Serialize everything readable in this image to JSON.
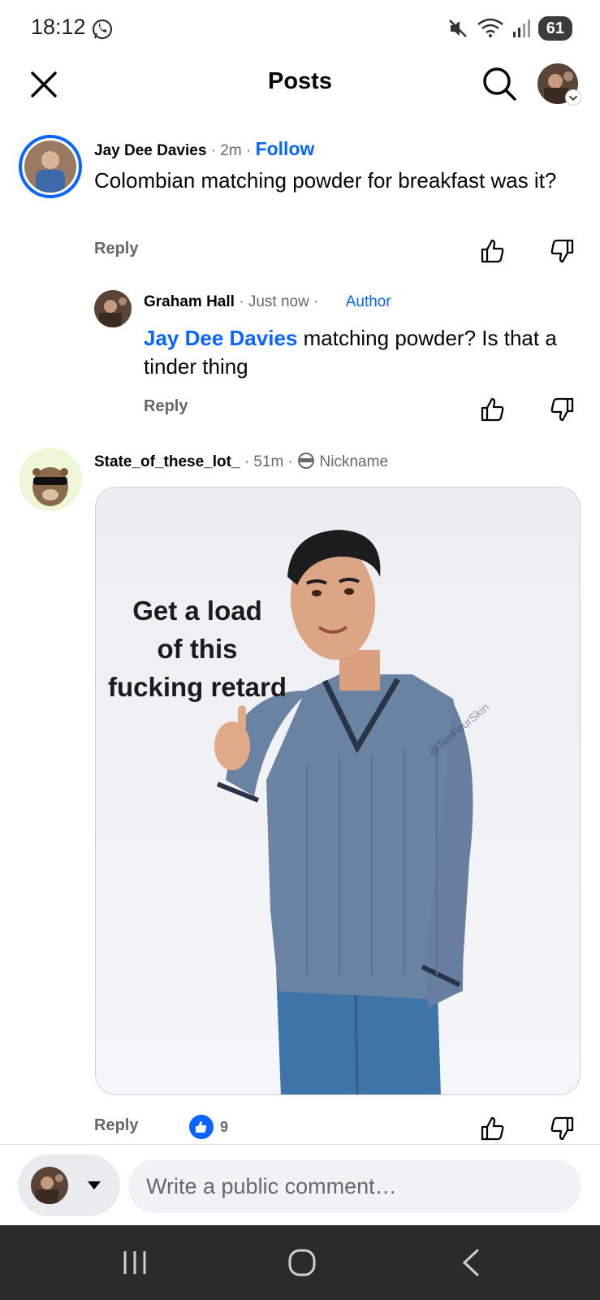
{
  "status_bar": {
    "time": "18:12",
    "battery": "61"
  },
  "header": {
    "title": "Posts"
  },
  "comments": [
    {
      "author": "Jay Dee Davies",
      "time": "· 2m ·",
      "follow_label": "Follow",
      "text": "Colombian matching powder for breakfast was it?",
      "reply_label": "Reply"
    },
    {
      "author": "Graham Hall",
      "time": "· Just now ·",
      "badge": "Author",
      "mention": "Jay Dee Davies",
      "text": " matching powder? Is that a tinder thing",
      "reply_label": "Reply"
    },
    {
      "author": "State_of_these_lot_",
      "time": "· 51m ·",
      "nickname_label": "Nickname",
      "meme_caption_lines": [
        "Get a load",
        "of this",
        "fucking retard"
      ],
      "meme_watermark": "@TenFourSkin",
      "reply_label": "Reply",
      "like_count": "9"
    }
  ],
  "composer": {
    "placeholder": "Write a public comment…"
  },
  "colors": {
    "accent": "#0866ff",
    "muted": "#65676b",
    "navbar": "#2b2b2b"
  }
}
